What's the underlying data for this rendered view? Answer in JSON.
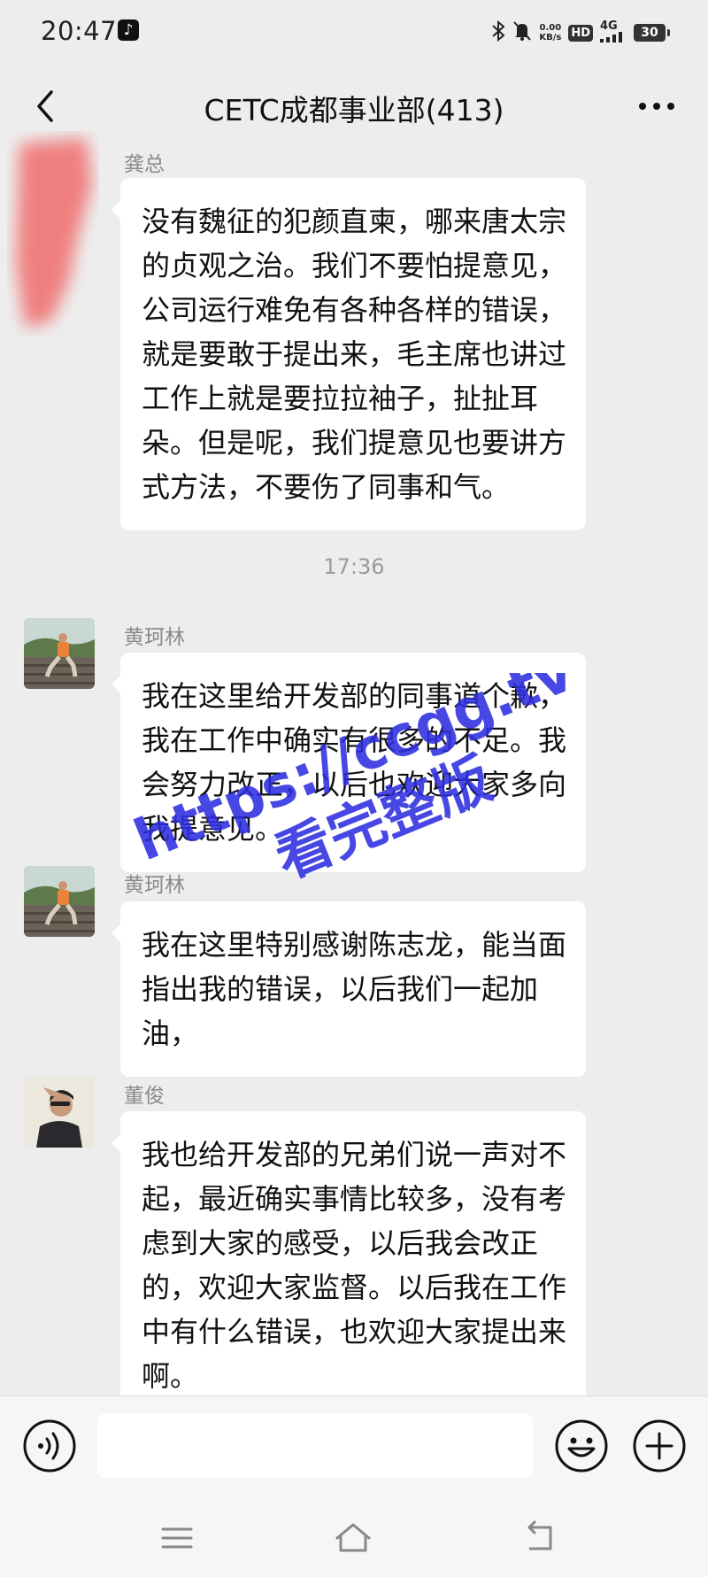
{
  "status_bar": {
    "time": "20:47",
    "app_icon": "tiktok-icon",
    "net_speed_value": "0.00",
    "net_speed_unit": "KB/s",
    "hd_label": "HD",
    "signal_label": "4G",
    "battery_level": "30"
  },
  "header": {
    "title": "CETC成都事业部(413)",
    "back_icon": "back-chevron-icon",
    "more_icon": "more-dots-icon"
  },
  "messages": [
    {
      "sender": "龚总",
      "avatar": "redacted-avatar",
      "text": "没有魏征的犯颜直柬，哪来唐太宗的贞观之治。我们不要怕提意见，公司运行难免有各种各样的错误，就是要敢于提出来，毛主席也讲过工作上就是要拉拉袖子，扯扯耳朵。但是呢，我们提意见也要讲方式方法，不要伤了同事和气。"
    },
    {
      "sender": "黄珂林",
      "avatar": "person-on-steps-avatar",
      "text": "我在这里给开发部的同事道个歉，我在工作中确实有很多的不足。我会努力改正，以后也欢迎大家多向我提意见。"
    },
    {
      "sender": "黄珂林",
      "avatar": "person-on-steps-avatar",
      "text": "我在这里特别感谢陈志龙，能当面指出我的错误，以后我们一起加油，"
    },
    {
      "sender": "董俊",
      "avatar": "man-saluting-avatar",
      "text": "我也给开发部的兄弟们说一声对不起，最近确实事情比较多，没有考虑到大家的感受，以后我会改正的，欢迎大家监督。以后我在工作中有什么错误，也欢迎大家提出来啊。"
    }
  ],
  "timestamp": "17:36",
  "watermark": {
    "line1": "https://ccgg.tv",
    "line2": "看完整版",
    "color": "#2d2de0"
  },
  "input_bar": {
    "placeholder": "",
    "voice_icon": "voice-input-icon",
    "emoji_icon": "emoji-icon",
    "plus_icon": "plus-icon"
  },
  "system_nav": {
    "menu_icon": "menu-icon",
    "home_icon": "home-icon",
    "back_icon": "back-arrow-icon"
  },
  "colors": {
    "background": "#ededed",
    "bubble": "#ffffff",
    "sender": "#8a8a8a",
    "timestamp": "#9a9a9a"
  }
}
